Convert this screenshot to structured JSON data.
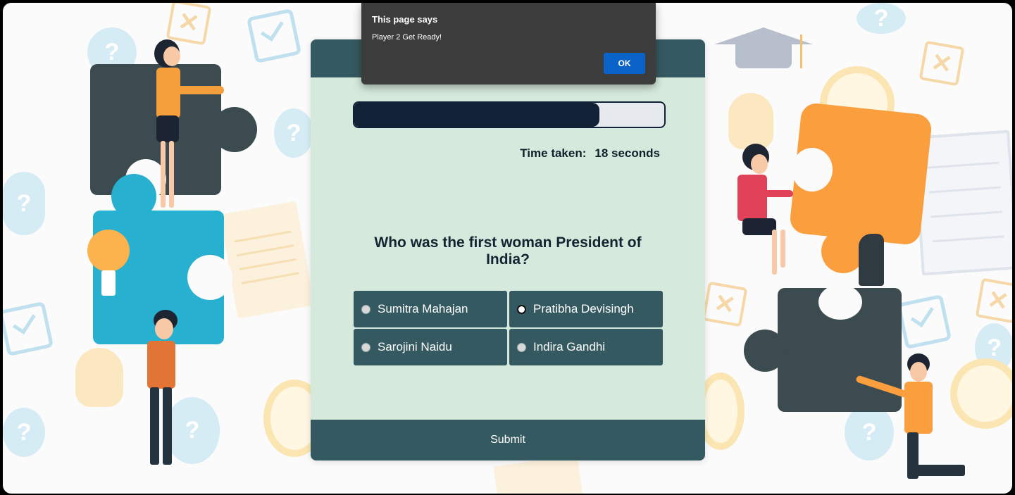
{
  "dialog": {
    "title": "This page says",
    "message": "Player 2 Get Ready!",
    "ok_label": "OK"
  },
  "quiz": {
    "progress_fraction": 0.79,
    "time_label": "Time taken:",
    "time_value": "18 seconds",
    "question": "Who was the first woman President of India?",
    "options": [
      {
        "label": "Sumitra Mahajan",
        "selected": false
      },
      {
        "label": "Pratibha Devisingh",
        "selected": true
      },
      {
        "label": "Sarojini Naidu",
        "selected": false
      },
      {
        "label": "Indira Gandhi",
        "selected": false
      }
    ],
    "submit_label": "Submit"
  },
  "background": {
    "question_mark": "?",
    "x_mark": "✕"
  },
  "colors": {
    "card_bg": "#d5eadd",
    "card_accent": "#355960",
    "progress_fill": "#112236",
    "dialog_bg": "#3c3c3c",
    "dialog_button": "#0a63c9"
  }
}
